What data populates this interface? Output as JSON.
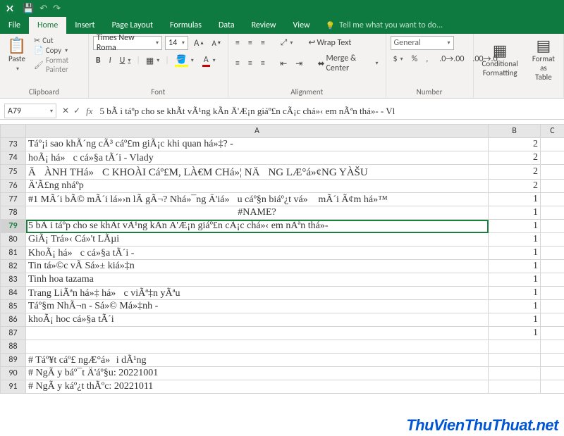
{
  "qat": {
    "save": "💾",
    "undo": "↶",
    "redo": "↷"
  },
  "tabs": {
    "file": "File",
    "home": "Home",
    "insert": "Insert",
    "pagelayout": "Page Layout",
    "formulas": "Formulas",
    "data": "Data",
    "review": "Review",
    "view": "View",
    "tellme": "Tell me what you want to do..."
  },
  "ribbon": {
    "clipboard": {
      "paste": "Paste",
      "cut": "Cut",
      "copy": "Copy",
      "fmtpainter": "Format Painter",
      "label": "Clipboard"
    },
    "font": {
      "name": "Times New Roma",
      "size": "14",
      "bold": "B",
      "italic": "I",
      "underline": "U",
      "label": "Font",
      "incfont": "A",
      "decfont": "A"
    },
    "alignment": {
      "wrap": "Wrap Text",
      "merge": "Merge & Center",
      "label": "Alignment"
    },
    "number": {
      "format": "General",
      "label": "Number"
    },
    "styles": {
      "cond": "Conditional\nFormatting",
      "fmttbl": "Format as\nTable"
    }
  },
  "namebox": "A79",
  "formulabar": "5 bÃ i táº­p cho se khÃ­t vÃ¹ng kÃ­n Ä'Æ¡n giáº£n cÃ¡c chá»‹ em nÃªn thá»­- - Vl",
  "cols": {
    "A": "A",
    "B": "B",
    "C": "C"
  },
  "rows": [
    {
      "n": "73",
      "a": "Táº¡i sao khÃ´ng cÃ³ cáº£m giÃ¡c khi quan há»‡? -",
      "b": "2"
    },
    {
      "n": "74",
      "a": "hoÃ¡ há»c cá»§a tÃ´i - Vlady",
      "b": "2"
    },
    {
      "n": "75",
      "a": "ÄÀNH THá»C KHOÀI Cáº£M, LÀ€M CHá»¦ NÄNG LÆ°á»¢NG YÀŠU",
      "b": "2",
      "spec": true
    },
    {
      "n": "76",
      "a": "Ä'Ã£ng nháº­p",
      "b": "2"
    },
    {
      "n": "77",
      "a": "#1 MÃ´i bÃ© mÃ´i lá»›n lÃ   gÃ¬? Nhá»¯ng Ä'iá»u cáº§n biáº¿t vá» mÃ´i Ã¢m há»™",
      "b": "1"
    },
    {
      "n": "78",
      "a": "#NAME?",
      "b": "1",
      "center": true
    },
    {
      "n": "79",
      "a": "5 bÃ i táº­p cho se khÃ­t vÃ¹ng kÃ­n Ä'Æ¡n giáº£n cÃ¡c chá»‹ em nÃªn thá»­-",
      "b": "1",
      "sel": true
    },
    {
      "n": "80",
      "a": "GiÃ¡ Trá»‹ Cá»'t LÃµi",
      "b": "1"
    },
    {
      "n": "81",
      "a": "KhoÃ¡ há»c cá»§a tÃ´i -",
      "b": "1"
    },
    {
      "n": "82",
      "a": "Tin tá»©c vÃ   Sá»± kiá»‡n",
      "b": "1"
    },
    {
      "n": "83",
      "a": "Tinh hoa tazama",
      "b": "1"
    },
    {
      "n": "84",
      "a": "Trang LiÃªn há»‡ há»c viÃª‡n yÃªu",
      "b": "1"
    },
    {
      "n": "85",
      "a": "Táº§m NhÃ¬n - Sá»© Má»‡nh -",
      "b": "1"
    },
    {
      "n": "86",
      "a": "khoÃ¡ hoc cá»§a tÃ´i",
      "b": "1"
    },
    {
      "n": "87",
      "a": "",
      "b": "1"
    },
    {
      "n": "88",
      "a": "",
      "b": ""
    },
    {
      "n": "89",
      "a": "# Táº¥t cáº£ ngÆ°á»i dÃ¹ng",
      "b": ""
    },
    {
      "n": "90",
      "a": "# NgÃ y báº¯t Ä'áº§u: 20221001",
      "b": ""
    },
    {
      "n": "91",
      "a": "# NgÃ y káº¿t thÃºc: 20221011",
      "b": ""
    }
  ],
  "watermark": "ThuVienThuThuat.net"
}
